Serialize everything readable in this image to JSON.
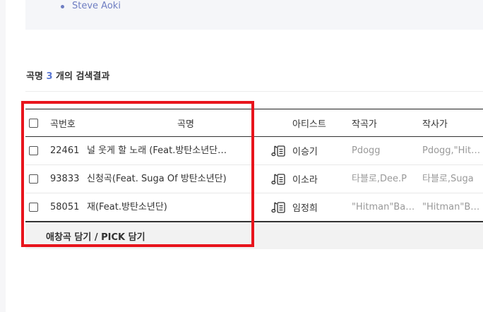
{
  "artists": {
    "items": [
      "Steve Aoki"
    ]
  },
  "results": {
    "prefix": "곡명",
    "count": "3",
    "suffix": "개의 검색결과"
  },
  "table": {
    "headers": {
      "number": "곡번호",
      "title": "곡명",
      "artist": "아티스트",
      "composer": "작곡가",
      "lyricist": "작사가"
    },
    "rows": [
      {
        "number": "22461",
        "title": "널 웃게 할 노래 (Feat.방탄소년단…",
        "artist": "이승기",
        "composer": "Pdogg",
        "lyricist": "Pdogg,\"Hit…"
      },
      {
        "number": "93833",
        "title": "신청곡(Feat. Suga Of 방탄소년단)",
        "artist": "이소라",
        "composer": "타블로,Dee.P",
        "lyricist": "타블로,Suga"
      },
      {
        "number": "58051",
        "title": "재(Feat.방탄소년단)",
        "artist": "임정희",
        "composer": "\"Hitman\"Ba…",
        "lyricist": "\"Hitman\"Ba…"
      }
    ]
  },
  "footer": {
    "action_label": "애창곡 담기 / PICK 담기"
  },
  "colors": {
    "accent": "#5b78d2",
    "link": "#6f7ec2",
    "highlight_border": "#e8141c"
  },
  "icons": {
    "lyrics": "music-note-lyrics-icon"
  }
}
